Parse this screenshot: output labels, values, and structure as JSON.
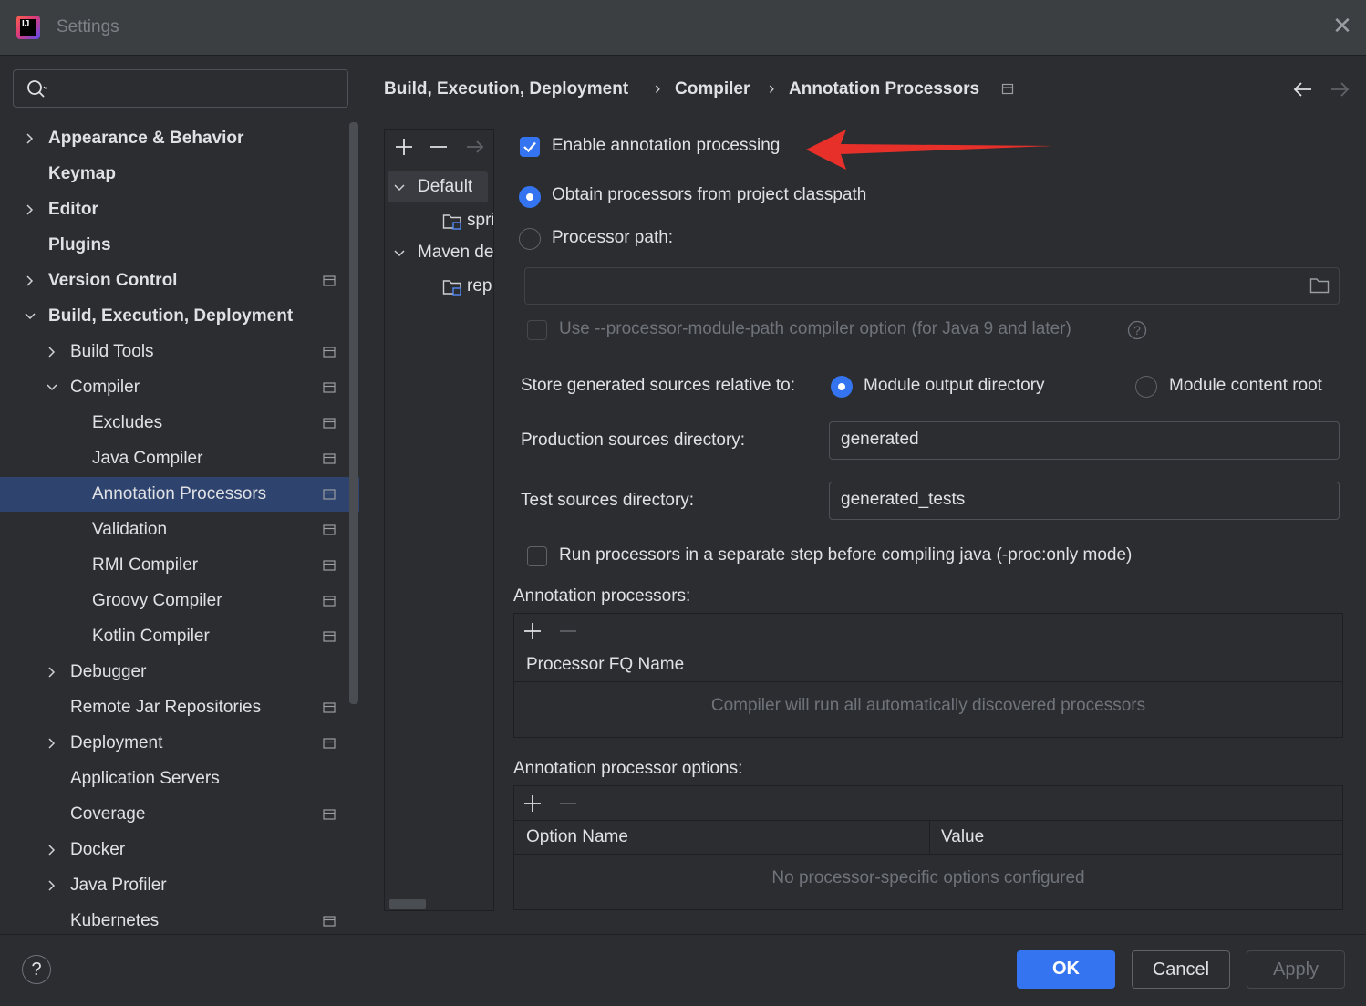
{
  "window": {
    "title": "Settings",
    "close_icon": "close-icon",
    "app_icon": "intellij-logo-icon"
  },
  "search": {
    "placeholder": "",
    "value": ""
  },
  "sidebar": {
    "items": [
      {
        "label": "Appearance & Behavior",
        "level": 0,
        "expandable": true,
        "expanded": false,
        "bold": true,
        "project_icon": false
      },
      {
        "label": "Keymap",
        "level": 0,
        "expandable": false,
        "bold": true,
        "project_icon": false
      },
      {
        "label": "Editor",
        "level": 0,
        "expandable": true,
        "expanded": false,
        "bold": true,
        "project_icon": false
      },
      {
        "label": "Plugins",
        "level": 0,
        "expandable": false,
        "bold": true,
        "project_icon": false
      },
      {
        "label": "Version Control",
        "level": 0,
        "expandable": true,
        "expanded": false,
        "bold": true,
        "project_icon": true
      },
      {
        "label": "Build, Execution, Deployment",
        "level": 0,
        "expandable": true,
        "expanded": true,
        "bold": true,
        "project_icon": false
      },
      {
        "label": "Build Tools",
        "level": 1,
        "expandable": true,
        "expanded": false,
        "bold": false,
        "project_icon": true
      },
      {
        "label": "Compiler",
        "level": 1,
        "expandable": true,
        "expanded": true,
        "bold": false,
        "project_icon": true
      },
      {
        "label": "Excludes",
        "level": 2,
        "expandable": false,
        "bold": false,
        "project_icon": true
      },
      {
        "label": "Java Compiler",
        "level": 2,
        "expandable": false,
        "bold": false,
        "project_icon": true
      },
      {
        "label": "Annotation Processors",
        "level": 2,
        "expandable": false,
        "bold": false,
        "project_icon": true,
        "selected": true
      },
      {
        "label": "Validation",
        "level": 2,
        "expandable": false,
        "bold": false,
        "project_icon": true
      },
      {
        "label": "RMI Compiler",
        "level": 2,
        "expandable": false,
        "bold": false,
        "project_icon": true
      },
      {
        "label": "Groovy Compiler",
        "level": 2,
        "expandable": false,
        "bold": false,
        "project_icon": true
      },
      {
        "label": "Kotlin Compiler",
        "level": 2,
        "expandable": false,
        "bold": false,
        "project_icon": true
      },
      {
        "label": "Debugger",
        "level": 1,
        "expandable": true,
        "expanded": false,
        "bold": false,
        "project_icon": false
      },
      {
        "label": "Remote Jar Repositories",
        "level": 1,
        "expandable": false,
        "bold": false,
        "project_icon": true
      },
      {
        "label": "Deployment",
        "level": 1,
        "expandable": true,
        "expanded": false,
        "bold": false,
        "project_icon": true
      },
      {
        "label": "Application Servers",
        "level": 1,
        "expandable": false,
        "bold": false,
        "project_icon": false
      },
      {
        "label": "Coverage",
        "level": 1,
        "expandable": false,
        "bold": false,
        "project_icon": true
      },
      {
        "label": "Docker",
        "level": 1,
        "expandable": true,
        "expanded": false,
        "bold": false,
        "project_icon": false
      },
      {
        "label": "Java Profiler",
        "level": 1,
        "expandable": true,
        "expanded": false,
        "bold": false,
        "project_icon": false
      },
      {
        "label": "Kubernetes",
        "level": 1,
        "expandable": false,
        "bold": false,
        "project_icon": true
      }
    ]
  },
  "breadcrumb": {
    "items": [
      "Build, Execution, Deployment",
      "Compiler",
      "Annotation Processors"
    ],
    "separator": "›"
  },
  "profiles": {
    "tree": [
      {
        "label": "Default",
        "type": "group",
        "expanded": true,
        "selected": true
      },
      {
        "label": "spri",
        "type": "module"
      },
      {
        "label": "Maven de",
        "type": "group",
        "expanded": true
      },
      {
        "label": "rep",
        "type": "module"
      }
    ]
  },
  "settings": {
    "enable_annotation_processing": {
      "label": "Enable annotation processing",
      "checked": true
    },
    "obtain_from_classpath": {
      "label": "Obtain processors from project classpath",
      "selected": true
    },
    "processor_path": {
      "label": "Processor path:",
      "selected": false,
      "value": ""
    },
    "processor_module_path": {
      "label": "Use --processor-module-path compiler option (for Java 9 and later)",
      "checked": false,
      "disabled": true
    },
    "store_generated": {
      "label": "Store generated sources relative to:",
      "options": [
        "Module output directory",
        "Module content root"
      ],
      "selected": "Module output directory"
    },
    "production_sources": {
      "label": "Production sources directory:",
      "value": "generated"
    },
    "test_sources": {
      "label": "Test sources directory:",
      "value": "generated_tests"
    },
    "run_separate_step": {
      "label": "Run processors in a separate step before compiling java (-proc:only mode)",
      "checked": false
    }
  },
  "processors_table": {
    "title": "Annotation processors:",
    "columns": [
      "Processor FQ Name"
    ],
    "empty_text": "Compiler will run all automatically discovered processors"
  },
  "options_table": {
    "title": "Annotation processor options:",
    "columns": [
      "Option Name",
      "Value"
    ],
    "empty_text": "No processor-specific options configured"
  },
  "footer": {
    "help_label": "?",
    "ok_label": "OK",
    "cancel_label": "Cancel",
    "apply_label": "Apply"
  },
  "colors": {
    "accent": "#3574f0",
    "selection": "#2e436e",
    "annotation_arrow": "#e8302a",
    "background": "#2b2d30"
  }
}
